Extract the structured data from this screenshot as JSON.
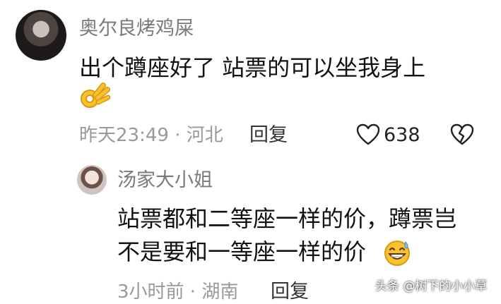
{
  "comment": {
    "user": "奥尔良烤鸡屎",
    "text": "出个蹲座好了 站票的可以坐我身上",
    "emoji": "ok-hand-emoji",
    "time_location": "昨天23:49 · 河北",
    "reply_label": "回复",
    "like_count": "638"
  },
  "reply": {
    "user": "汤家大小姐",
    "line1": "站票都和二等座一样的价，蹲票岂",
    "line2": "不是要和一等座一样的价",
    "emoji": "grin-sweat-emoji",
    "time_location": "3小时前 · 湖南",
    "reply_label": "回复"
  },
  "watermark": "头条 @树下的小小草",
  "colors": {
    "meta": "#999999",
    "name": "#7a7a7a",
    "emoji": "#f7c12f"
  }
}
